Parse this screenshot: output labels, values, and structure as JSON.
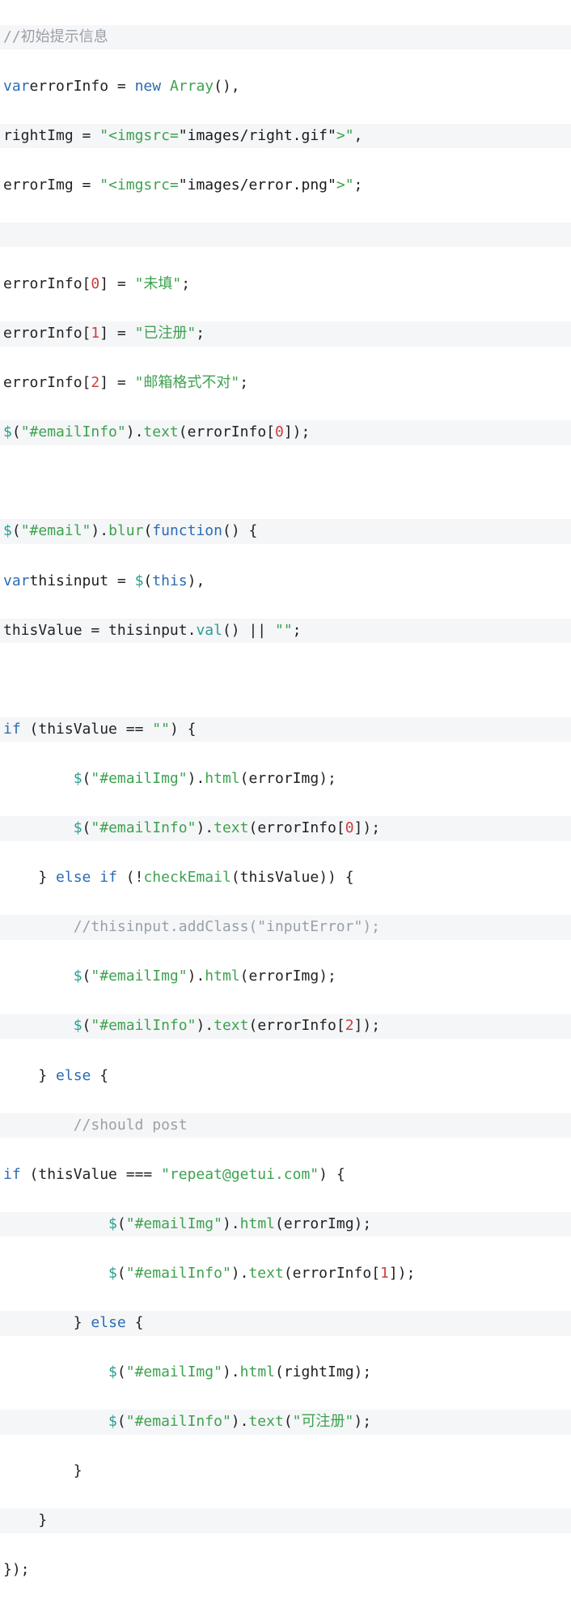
{
  "lines": {
    "l0": {
      "comment": "//初始提示信息"
    },
    "l1": {
      "kw1": "var",
      "id": "errorInfo",
      "eq": " = ",
      "kw2": "new",
      "sp": " ",
      "fn": "Array",
      "rest": "(),"
    },
    "l2": {
      "id": "rightImg",
      "eq": " = ",
      "q1": "\"",
      "tag_open": "<imgsrc=",
      "q2": "\"",
      "path": "images/right.gif",
      "q3": "\"",
      "gt": ">",
      "q4": "\"",
      "end": ","
    },
    "l3": {
      "id": "errorImg",
      "eq": " = ",
      "q1": "\"",
      "tag_open": "<imgsrc=",
      "q2": "\"",
      "path": "images/error.png",
      "q3": "\"",
      "gt": ">",
      "q4": "\"",
      "end": ";"
    },
    "l5": {
      "id": "errorInfo",
      "lb": "[",
      "n": "0",
      "rb": "]",
      "eq": " = ",
      "s": "\"未填\"",
      "end": ";"
    },
    "l6": {
      "id": "errorInfo",
      "lb": "[",
      "n": "1",
      "rb": "]",
      "eq": " = ",
      "s": "\"已注册\"",
      "end": ";"
    },
    "l7": {
      "id": "errorInfo",
      "lb": "[",
      "n": "2",
      "rb": "]",
      "eq": " = ",
      "s": "\"邮箱格式不对\"",
      "end": ";"
    },
    "l8": {
      "d": "$",
      "p1": "(",
      "s": "\"#emailInfo\"",
      "p2": ").",
      "fn": "text",
      "p3": "(errorInfo[",
      "n": "0",
      "p4": "]);"
    },
    "l10": {
      "d": "$",
      "p1": "(",
      "s": "\"#email\"",
      "p2": ").",
      "fn": "blur",
      "p3": "(",
      "kw": "function",
      "p4": "() {"
    },
    "l11": {
      "kw": "var",
      "id": "thisinput",
      "eq": " = ",
      "d": "$",
      "p1": "(",
      "th": "this",
      "p2": "),"
    },
    "l12": {
      "id": "thisValue",
      "eq": " = thisinput.",
      "fn": "val",
      "p": "() || ",
      "s": "\"\"",
      "end": ";"
    },
    "l14": {
      "kw": "if",
      "p1": " (thisValue == ",
      "s": "\"\"",
      "p2": ") {"
    },
    "l15": {
      "pad": "        ",
      "d": "$",
      "p1": "(",
      "s": "\"#emailImg\"",
      "p2": ").",
      "fn": "html",
      "p3": "(errorImg);"
    },
    "l16": {
      "pad": "        ",
      "d": "$",
      "p1": "(",
      "s": "\"#emailInfo\"",
      "p2": ").",
      "fn": "text",
      "p3": "(errorInfo[",
      "n": "0",
      "p4": "]);"
    },
    "l17": {
      "pad": "    ",
      "rb": "} ",
      "kw1": "else",
      "sp": " ",
      "kw2": "if",
      "p1": " (!",
      "fn": "checkEmail",
      "p2": "(thisValue)) {"
    },
    "l18": {
      "pad": "        ",
      "comment": "//thisinput.addClass(\"inputError\");"
    },
    "l19": {
      "pad": "        ",
      "d": "$",
      "p1": "(",
      "s": "\"#emailImg\"",
      "p2": ").",
      "fn": "html",
      "p3": "(errorImg);"
    },
    "l20": {
      "pad": "        ",
      "d": "$",
      "p1": "(",
      "s": "\"#emailInfo\"",
      "p2": ").",
      "fn": "text",
      "p3": "(errorInfo[",
      "n": "2",
      "p4": "]);"
    },
    "l21": {
      "pad": "    ",
      "rb": "} ",
      "kw": "else",
      "p": " {"
    },
    "l22": {
      "pad": "        ",
      "comment": "//should post"
    },
    "l23": {
      "kw": "if",
      "p1": " (thisValue === ",
      "s": "\"repeat@getui.com\"",
      "p2": ") {"
    },
    "l24": {
      "pad": "            ",
      "d": "$",
      "p1": "(",
      "s": "\"#emailImg\"",
      "p2": ").",
      "fn": "html",
      "p3": "(errorImg);"
    },
    "l25": {
      "pad": "            ",
      "d": "$",
      "p1": "(",
      "s": "\"#emailInfo\"",
      "p2": ").",
      "fn": "text",
      "p3": "(errorInfo[",
      "n": "1",
      "p4": "]);"
    },
    "l26": {
      "pad": "        ",
      "rb": "} ",
      "kw": "else",
      "p": " {"
    },
    "l27": {
      "pad": "            ",
      "d": "$",
      "p1": "(",
      "s": "\"#emailImg\"",
      "p2": ").",
      "fn": "html",
      "p3": "(rightImg);"
    },
    "l28": {
      "pad": "            ",
      "d": "$",
      "p1": "(",
      "s": "\"#emailInfo\"",
      "p2": ").",
      "fn": "text",
      "p3": "(",
      "s2": "\"可注册\"",
      "p4": ");"
    },
    "l29": {
      "pad": "        ",
      "rb": "}"
    },
    "l30": {
      "pad": "    ",
      "rb": "}"
    },
    "l31": {
      "rb": "});"
    }
  }
}
